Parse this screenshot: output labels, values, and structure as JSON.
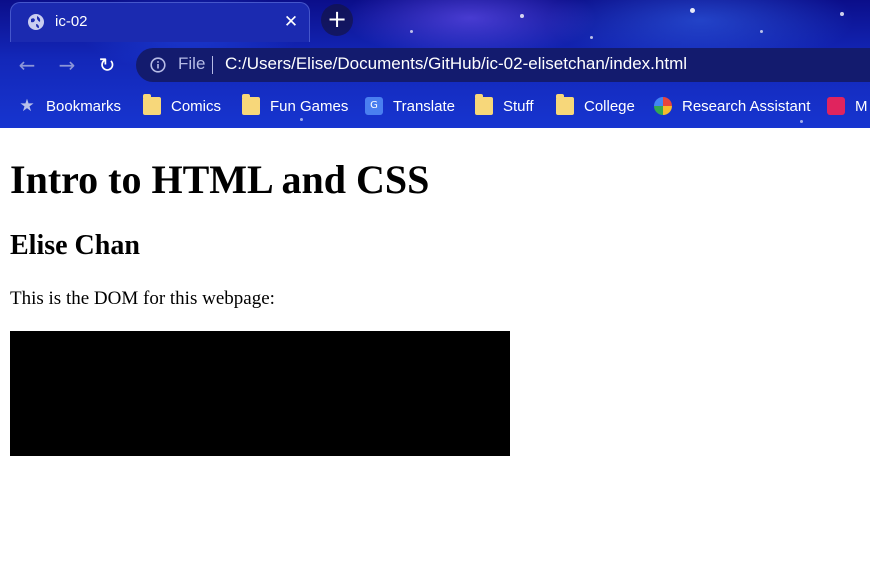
{
  "browser": {
    "tab": {
      "title": "ic-02",
      "favicon": "globe-icon",
      "close_icon": "close-icon"
    },
    "new_tab_icon": "plus-icon",
    "toolbar": {
      "back_icon": "arrow-left-icon",
      "forward_icon": "arrow-right-icon",
      "reload_icon": "reload-icon",
      "info_icon": "info-icon",
      "scheme_label": "File",
      "url": "C:/Users/Elise/Documents/GitHub/ic-02-elisetchan/index.html"
    },
    "bookmarks": [
      {
        "label": "Bookmarks",
        "icon": "star-icon"
      },
      {
        "label": "Comics",
        "icon": "folder-icon"
      },
      {
        "label": "Fun Games",
        "icon": "folder-icon"
      },
      {
        "label": "Translate",
        "icon": "translate-icon"
      },
      {
        "label": "Stuff",
        "icon": "folder-icon"
      },
      {
        "label": "College",
        "icon": "folder-icon"
      },
      {
        "label": "Research Assistant",
        "icon": "research-icon"
      },
      {
        "label": "M",
        "icon": "gift-icon"
      }
    ]
  },
  "page": {
    "heading": "Intro to HTML and CSS",
    "subheading": "Elise Chan",
    "paragraph": "This is the DOM for this webpage:"
  },
  "colors": {
    "chrome_blue": "#1735d0",
    "tab_blue": "#1b2ab0",
    "omnibox": "#131b6e",
    "page_background": "#ffffff",
    "dom_box": "#000000"
  }
}
